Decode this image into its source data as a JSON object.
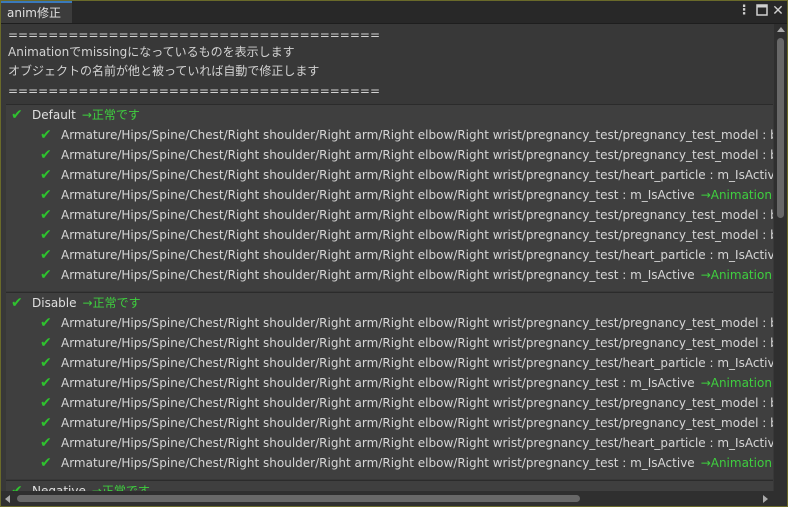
{
  "tab": {
    "title": "anim修正"
  },
  "toolbar": {
    "menu_icon": "kebab-menu-icon",
    "maximize_icon": "maximize-icon",
    "close_icon": "close-icon"
  },
  "header": {
    "separator": "=====================================",
    "line1": "Animationでmissingになっているものを表示します",
    "line2": "オブジェクトの名前が他と被っていれば自動で修正します"
  },
  "colors": {
    "check": "#2fc22f",
    "ok_text": "#3fcf3f",
    "tab_accent": "#3a79bb"
  },
  "groups": [
    {
      "name": "Default",
      "status": "→正常です",
      "items": [
        {
          "path": "Armature/Hips/Spine/Chest/Right shoulder/Right arm/Right elbow/Right wrist/pregnancy_test/pregnancy_test_model : blendShap",
          "note": ""
        },
        {
          "path": "Armature/Hips/Spine/Chest/Right shoulder/Right arm/Right elbow/Right wrist/pregnancy_test/pregnancy_test_model : blendShap",
          "note": ""
        },
        {
          "path": "Armature/Hips/Spine/Chest/Right shoulder/Right arm/Right elbow/Right wrist/pregnancy_test/heart_particle : m_IsActive",
          "note": "→Anim"
        },
        {
          "path": "Armature/Hips/Spine/Chest/Right shoulder/Right arm/Right elbow/Right wrist/pregnancy_test : m_IsActive",
          "note": "→Animationのパスを変"
        },
        {
          "path": "Armature/Hips/Spine/Chest/Right shoulder/Right arm/Right elbow/Right wrist/pregnancy_test/pregnancy_test_model : blendShap",
          "note": ""
        },
        {
          "path": "Armature/Hips/Spine/Chest/Right shoulder/Right arm/Right elbow/Right wrist/pregnancy_test/pregnancy_test_model : blendShap",
          "note": ""
        },
        {
          "path": "Armature/Hips/Spine/Chest/Right shoulder/Right arm/Right elbow/Right wrist/pregnancy_test/heart_particle : m_IsActive",
          "note": "→Anim"
        },
        {
          "path": "Armature/Hips/Spine/Chest/Right shoulder/Right arm/Right elbow/Right wrist/pregnancy_test : m_IsActive",
          "note": "→Animationのパスを変"
        }
      ]
    },
    {
      "name": "Disable",
      "status": "→正常です",
      "items": [
        {
          "path": "Armature/Hips/Spine/Chest/Right shoulder/Right arm/Right elbow/Right wrist/pregnancy_test/pregnancy_test_model : blendShap",
          "note": ""
        },
        {
          "path": "Armature/Hips/Spine/Chest/Right shoulder/Right arm/Right elbow/Right wrist/pregnancy_test/pregnancy_test_model : blendShap",
          "note": ""
        },
        {
          "path": "Armature/Hips/Spine/Chest/Right shoulder/Right arm/Right elbow/Right wrist/pregnancy_test/heart_particle : m_IsActive",
          "note": "→Anim"
        },
        {
          "path": "Armature/Hips/Spine/Chest/Right shoulder/Right arm/Right elbow/Right wrist/pregnancy_test : m_IsActive",
          "note": "→Animationのパスを変"
        },
        {
          "path": "Armature/Hips/Spine/Chest/Right shoulder/Right arm/Right elbow/Right wrist/pregnancy_test/pregnancy_test_model : blendShap",
          "note": ""
        },
        {
          "path": "Armature/Hips/Spine/Chest/Right shoulder/Right arm/Right elbow/Right wrist/pregnancy_test/pregnancy_test_model : blendShap",
          "note": ""
        },
        {
          "path": "Armature/Hips/Spine/Chest/Right shoulder/Right arm/Right elbow/Right wrist/pregnancy_test/heart_particle : m_IsActive",
          "note": "→Anim"
        },
        {
          "path": "Armature/Hips/Spine/Chest/Right shoulder/Right arm/Right elbow/Right wrist/pregnancy_test : m_IsActive",
          "note": "→Animationのパスを変"
        }
      ]
    },
    {
      "name": "Negative",
      "status": "→正常です",
      "items": []
    }
  ]
}
